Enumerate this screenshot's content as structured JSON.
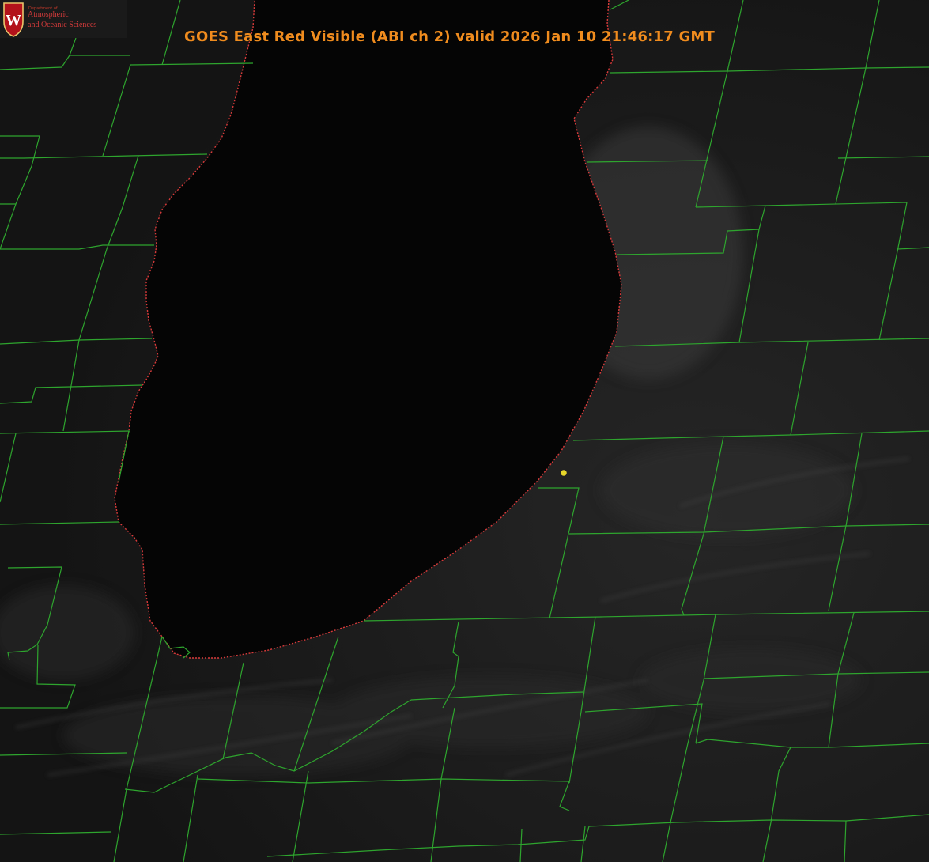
{
  "title": "GOES East Red Visible (ABI ch 2) valid 2026 Jan 10 21:46:17 GMT",
  "logo": {
    "department": "Department of",
    "line1": "Atmospheric",
    "line2": "and Oceanic Sciences",
    "crest_letter": "W"
  },
  "map": {
    "product": "GOES East Red Visible (ABI ch 2)",
    "background": "#000000",
    "boundary_color": "#2ea52e",
    "coastline_color": "#d83a3a",
    "marker_color": "#e6d62a",
    "title_color": "#f08c1e",
    "logo_accent": "#b3121b"
  }
}
